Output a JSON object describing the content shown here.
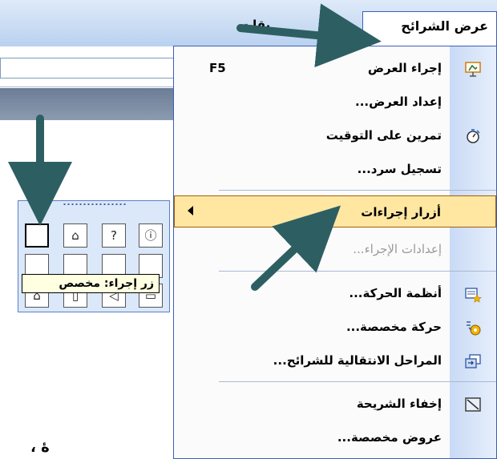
{
  "menubar": {
    "partial_left_label": "يقات",
    "active_menu_label": "عرض الشرائح"
  },
  "menu": {
    "items": [
      {
        "label": "إجراء العرض",
        "shortcut": "F5",
        "icon": "slideshow-icon"
      },
      {
        "label": "إعداد العرض...",
        "icon": ""
      },
      {
        "label": "تمرين على التوقيت",
        "icon": "stopwatch-icon"
      },
      {
        "label": "تسجيل سرد...",
        "icon": ""
      },
      {
        "label": "أزرار إجراءات",
        "icon": "",
        "submenu": true
      },
      {
        "label": "إعدادات الإجراء...",
        "icon": "",
        "disabled": true
      },
      {
        "label": "أنظمة الحركة...",
        "icon": "animation-schemes-icon"
      },
      {
        "label": "حركة مخصصة...",
        "icon": "custom-animation-icon"
      },
      {
        "label": "المراحل الانتقالية للشرائح...",
        "icon": "slide-transition-icon"
      },
      {
        "label": "إخفاء الشريحة",
        "icon": "hide-slide-icon"
      },
      {
        "label": "عروض مخصصة...",
        "icon": ""
      }
    ]
  },
  "toolbar": {
    "tooltip": "زر إجراء: مخصص",
    "buttons_row1": [
      "",
      "⌂",
      "?",
      "ⓘ"
    ],
    "buttons_row3": [
      "⌂",
      "▯",
      "◁",
      "▭"
    ]
  },
  "background": {
    "bottom_text": "، ۀ"
  },
  "colors": {
    "menu_border": "#3c5fb7",
    "highlight": "#ffe7a2",
    "arrow": "#2d5f62"
  }
}
